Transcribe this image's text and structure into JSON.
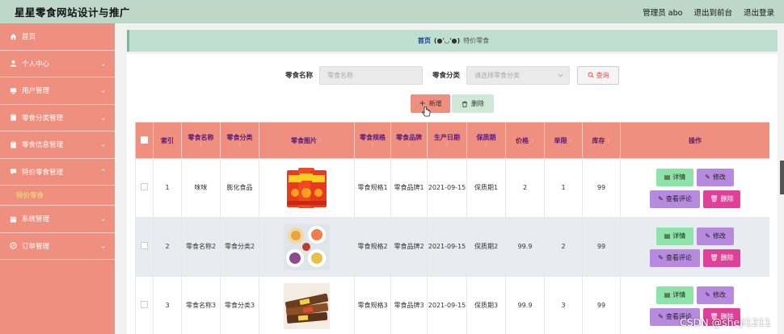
{
  "header": {
    "title": "星星零食网站设计与推广",
    "links": [
      "管理员 abo",
      "退出到前台",
      "退出登录"
    ]
  },
  "sidebar": {
    "items": [
      {
        "label": "首页",
        "icon": "home-icon",
        "chevron": ""
      },
      {
        "label": "个人中心",
        "icon": "user-icon",
        "chevron": "⌄"
      },
      {
        "label": "用户管理",
        "icon": "monitor-icon",
        "chevron": "⌄"
      },
      {
        "label": "零食分类管理",
        "icon": "clipboard-icon",
        "chevron": "⌄"
      },
      {
        "label": "零食信息管理",
        "icon": "clipboard-icon",
        "chevron": "⌄"
      },
      {
        "label": "特价零食管理",
        "icon": "chat-icon",
        "chevron": "⌃"
      },
      {
        "label": "系统管理",
        "icon": "calendar-icon",
        "chevron": "⌄"
      },
      {
        "label": "订单管理",
        "icon": "compass-icon",
        "chevron": "⌄"
      }
    ],
    "active_sub": "特价零食"
  },
  "breadcrumb": {
    "home": "首页",
    "sep": "(●'◡'●)",
    "current": "特价零食"
  },
  "search": {
    "name_label": "零食名称",
    "name_placeholder": "零食名称",
    "category_label": "零食分类",
    "category_placeholder": "请选择零食分类",
    "search_button": "查询"
  },
  "actions": {
    "add": "新增",
    "delete": "删除"
  },
  "table": {
    "headers": [
      "索引",
      "零食名称",
      "零食分类",
      "零食图片",
      "零食规格",
      "零食品牌",
      "生产日期",
      "保质期",
      "价格",
      "单限",
      "库存",
      "操作"
    ],
    "rows": [
      {
        "index": "1",
        "name": "咪咪",
        "category": "膨化食品",
        "spec": "零食规格1",
        "brand": "零食品牌1",
        "date": "2021-09-15",
        "shelf": "保质期1",
        "price": "2",
        "limit": "1",
        "stock": "99"
      },
      {
        "index": "2",
        "name": "零食名称2",
        "category": "零食分类2",
        "spec": "零食规格2",
        "brand": "零食品牌2",
        "date": "2021-09-15",
        "shelf": "保质期2",
        "price": "99.9",
        "limit": "2",
        "stock": "99"
      },
      {
        "index": "3",
        "name": "零食名称3",
        "category": "零食分类3",
        "spec": "零食规格3",
        "brand": "零食品牌3",
        "date": "2021-09-15",
        "shelf": "保质期3",
        "price": "99.9",
        "limit": "3",
        "stock": "99"
      }
    ],
    "op_labels": {
      "detail": "详情",
      "edit": "修改",
      "comment": "查看评论",
      "delete": "删除"
    }
  },
  "watermark": "CSDN @sheji1211",
  "colors": {
    "topbar": "#bdd8c8",
    "sidebar": "#ef8f7f",
    "header_row": "#ef8f7f",
    "detail_btn": "#8ee3a8",
    "edit_btn": "#b78ae0",
    "delete_btn": "#e0409a"
  }
}
